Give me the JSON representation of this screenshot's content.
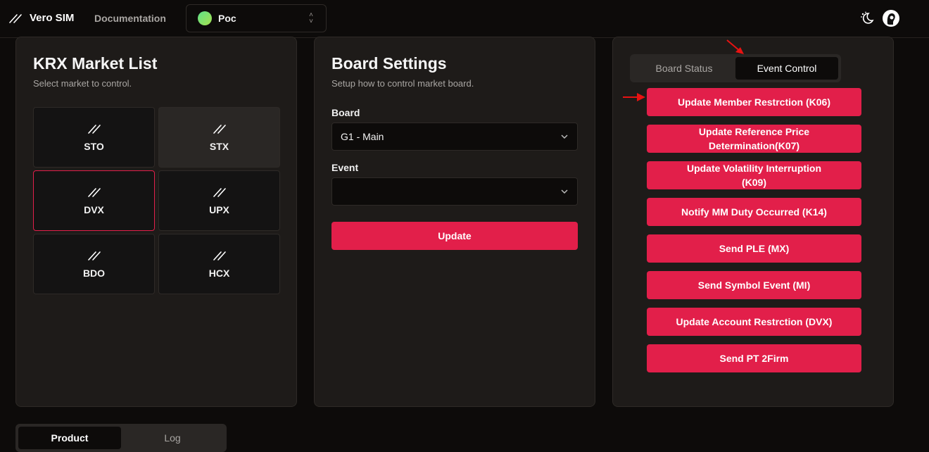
{
  "header": {
    "app_name": "Vero SIM",
    "doc_link": "Documentation",
    "environment": "Poc",
    "theme_icon": "moon-sun-icon",
    "avatar_icon": "user-avatar"
  },
  "market_list": {
    "title": "KRX Market List",
    "subtitle": "Select market to control.",
    "markets": [
      {
        "label": "STO"
      },
      {
        "label": "STX"
      },
      {
        "label": "DVX"
      },
      {
        "label": "UPX"
      },
      {
        "label": "BDO"
      },
      {
        "label": "HCX"
      }
    ],
    "selected": "DVX"
  },
  "board_settings": {
    "title": "Board Settings",
    "subtitle": "Setup how to control market board.",
    "board_label": "Board",
    "board_value": "G1 - Main",
    "event_label": "Event",
    "event_value": "",
    "update_button": "Update"
  },
  "control_panel": {
    "tabs": [
      {
        "label": "Board Status",
        "active": false
      },
      {
        "label": "Event Control",
        "active": true
      }
    ],
    "events": [
      "Update Member Restrction (K06)",
      "Update Reference Price Determination(K07)",
      "Update Volatility Interruption (K09)",
      "Notify MM Duty Occurred (K14)",
      "Send PLE (MX)",
      "Send Symbol Event (MI)",
      "Update Account Restrction (DVX)",
      "Send PT 2Firm"
    ]
  },
  "bottom_tabs": [
    {
      "label": "Product",
      "active": true
    },
    {
      "label": "Log",
      "active": false
    }
  ],
  "colors": {
    "accent": "#e21f4a",
    "background": "#0d0b0a",
    "card": "#1e1b19",
    "annotation_arrow": "#e81212"
  }
}
